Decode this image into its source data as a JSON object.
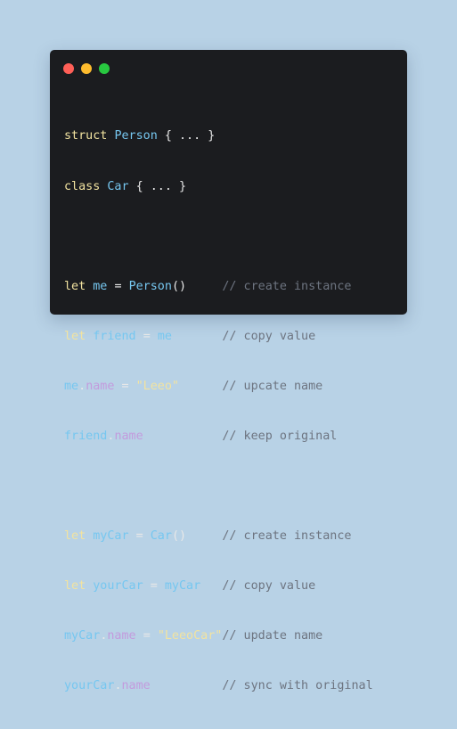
{
  "window": {
    "controls": [
      {
        "name": "close",
        "color": "#ff5f57"
      },
      {
        "name": "minimize",
        "color": "#febc2e"
      },
      {
        "name": "zoom",
        "color": "#28c840"
      }
    ]
  },
  "code": {
    "line1": {
      "kw": "struct",
      "type": "Person",
      "rest": "{ ... }"
    },
    "line2": {
      "kw": "class",
      "type": "Car",
      "rest": "{ ... }"
    },
    "line3": {
      "kw": "let",
      "var": "me",
      "eq": "=",
      "call": "Person",
      "parens": "()",
      "comment": "// create instance"
    },
    "line4": {
      "kw": "let",
      "var": "friend",
      "eq": "=",
      "rhs": "me",
      "comment": "// copy value"
    },
    "line5": {
      "obj": "me",
      "dot": ".",
      "prop": "name",
      "eq": "=",
      "str": "\"Leeo\"",
      "comment": "// upcate name"
    },
    "line6": {
      "obj": "friend",
      "dot": ".",
      "prop": "name",
      "comment": "// keep original"
    },
    "line7": {
      "kw": "let",
      "var": "myCar",
      "eq": "=",
      "call": "Car",
      "parens": "()",
      "comment": "// create instance"
    },
    "line8": {
      "kw": "let",
      "var": "yourCar",
      "eq": "=",
      "rhs": "myCar",
      "comment": "// copy value"
    },
    "line9": {
      "obj": "myCar",
      "dot": ".",
      "prop": "name",
      "eq": "=",
      "str": "\"LeeoCar\"",
      "comment": "// update name"
    },
    "line10": {
      "obj": "yourCar",
      "dot": ".",
      "prop": "name",
      "comment": "// sync with original"
    }
  }
}
